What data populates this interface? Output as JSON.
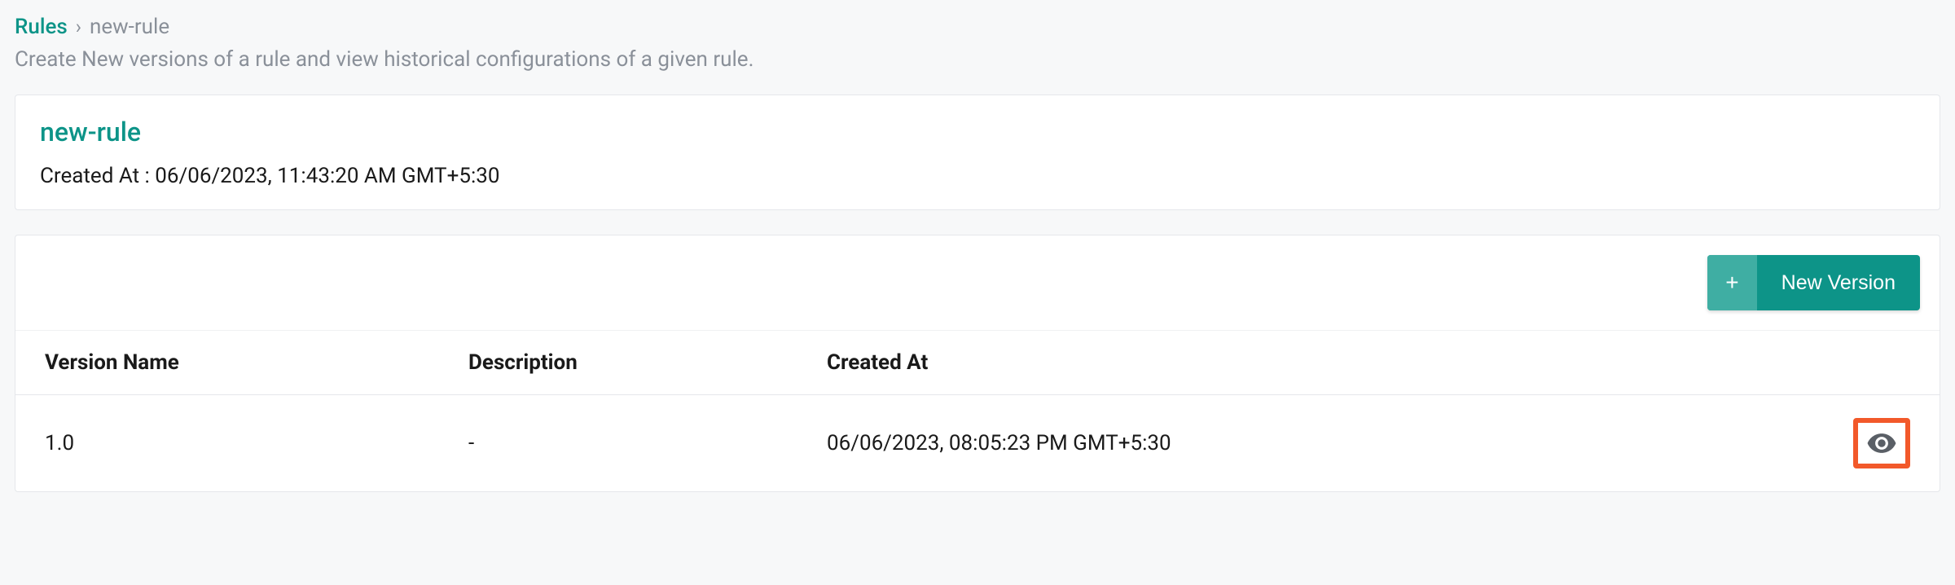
{
  "breadcrumb": {
    "root": "Rules",
    "separator": "›",
    "current": "new-rule"
  },
  "page": {
    "subtitle": "Create New versions of a rule and view historical configurations of a given rule."
  },
  "rule": {
    "name": "new-rule",
    "created_at_label": "Created At : 06/06/2023, 11:43:20 AM GMT+5:30"
  },
  "toolbar": {
    "new_version_label": "New Version"
  },
  "table": {
    "headers": {
      "version_name": "Version Name",
      "description": "Description",
      "created_at": "Created At"
    },
    "rows": [
      {
        "version_name": "1.0",
        "description": "-",
        "created_at": "06/06/2023, 08:05:23 PM GMT+5:30"
      }
    ]
  }
}
